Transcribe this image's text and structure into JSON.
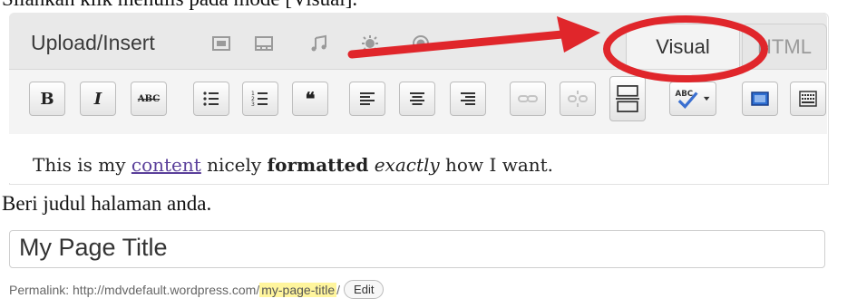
{
  "instructions": {
    "step1": "Silahkan klik menulis pada mode [Visual].",
    "step2": "Beri judul halaman anda."
  },
  "editor": {
    "upload_label": "Upload/Insert",
    "media_icons": [
      "image-icon",
      "video-icon",
      "audio-icon",
      "media-icon",
      "gallery-icon"
    ],
    "tabs": {
      "visual": "Visual",
      "html": "HTML"
    },
    "toolbar": {
      "bold": "B",
      "italic": "I",
      "strikethrough": "ABC",
      "buttons": [
        "bold",
        "italic",
        "strikethrough",
        "bullet-list",
        "numbered-list",
        "blockquote",
        "align-left",
        "align-center",
        "align-right",
        "link",
        "unlink",
        "more",
        "spellcheck",
        "fullscreen",
        "kitchen-sink"
      ]
    },
    "content": {
      "before_link": "This is my ",
      "link": "content",
      "middle": " nicely ",
      "bold": "formatted",
      "space": " ",
      "italic": "exactly",
      "after": " how I want."
    }
  },
  "title": {
    "value": "My Page Title",
    "permalink_label": "Permalink: http://mdvdefault.wordpress.com/",
    "permalink_slug": "my-page-title",
    "permalink_end": "/",
    "edit_label": "Edit"
  },
  "colors": {
    "annotation": "#e0262b",
    "link": "#5a3f9a",
    "slug_highlight": "#fff59d"
  }
}
